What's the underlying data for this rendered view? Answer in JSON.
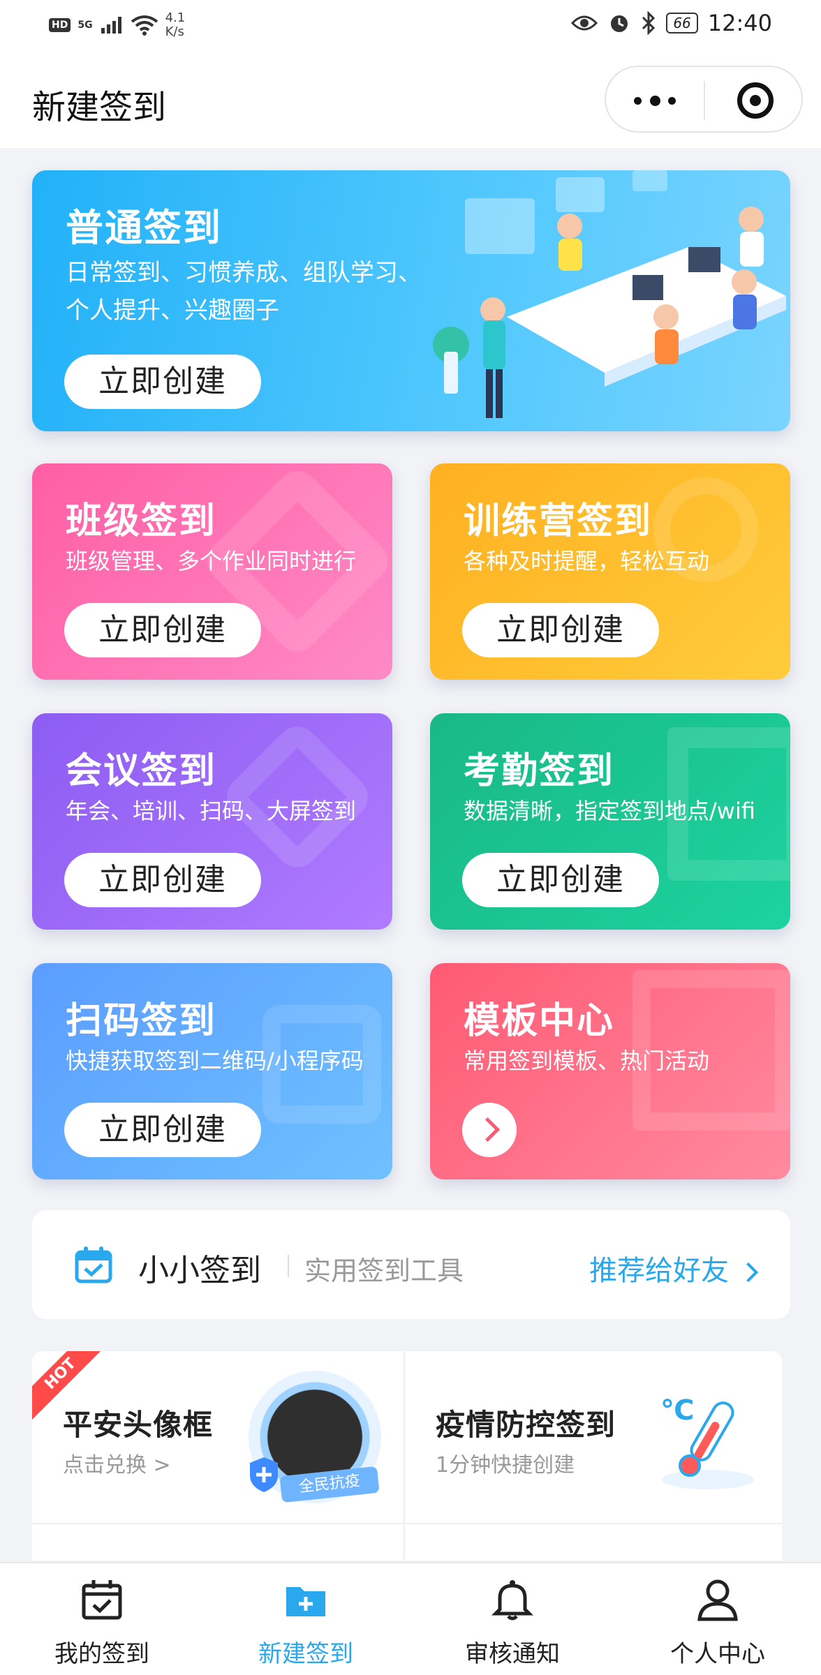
{
  "status_bar": {
    "hd": "HD",
    "net": "5G",
    "speed": "4.1\nK/s",
    "battery": "66",
    "time": "12:40"
  },
  "header": {
    "title": "新建签到"
  },
  "cards": {
    "main": {
      "title": "普通签到",
      "desc_line1": "日常签到、习惯养成、组队学习、",
      "desc_line2": "个人提升、兴趣圈子",
      "button": "立即创建"
    },
    "class": {
      "title": "班级签到",
      "desc": "班级管理、多个作业同时进行",
      "button": "立即创建"
    },
    "camp": {
      "title": "训练营签到",
      "desc": "各种及时提醒，轻松互动",
      "button": "立即创建"
    },
    "meeting": {
      "title": "会议签到",
      "desc": "年会、培训、扫码、大屏签到",
      "button": "立即创建"
    },
    "attendance": {
      "title": "考勤签到",
      "desc": "数据清晰，指定签到地点/wifi",
      "button": "立即创建"
    },
    "scan": {
      "title": "扫码签到",
      "desc": "快捷获取签到二维码/小程序码",
      "button": "立即创建"
    },
    "template": {
      "title": "模板中心",
      "desc": "常用签到模板、热门活动"
    }
  },
  "promo": {
    "name": "小小签到",
    "tagline": "实用签到工具",
    "share": "推荐给好友"
  },
  "activities": {
    "hot_badge": "HOT",
    "avatar_frame": {
      "title": "平安头像框",
      "sub": "点击兑换 >"
    },
    "epidemic": {
      "title": "疫情防控签到",
      "sub": "1分钟快捷创建"
    },
    "ribbon_text": "全民抗疫",
    "temp_unit": "℃"
  },
  "tabbar": [
    {
      "label": "我的签到",
      "icon": "calendar-check-icon"
    },
    {
      "label": "新建签到",
      "icon": "folder-plus-icon"
    },
    {
      "label": "审核通知",
      "icon": "bell-icon"
    },
    {
      "label": "个人中心",
      "icon": "person-icon"
    }
  ],
  "colors": {
    "accent": "#2aa8ee",
    "main_card": "#22b1f8",
    "class_card": "#ff5ea4",
    "camp_card": "#ffb020",
    "meeting_card": "#8d5cf2",
    "attendance_card": "#19b885",
    "scan_card": "#5b9dff",
    "template_card": "#ff5a73"
  }
}
